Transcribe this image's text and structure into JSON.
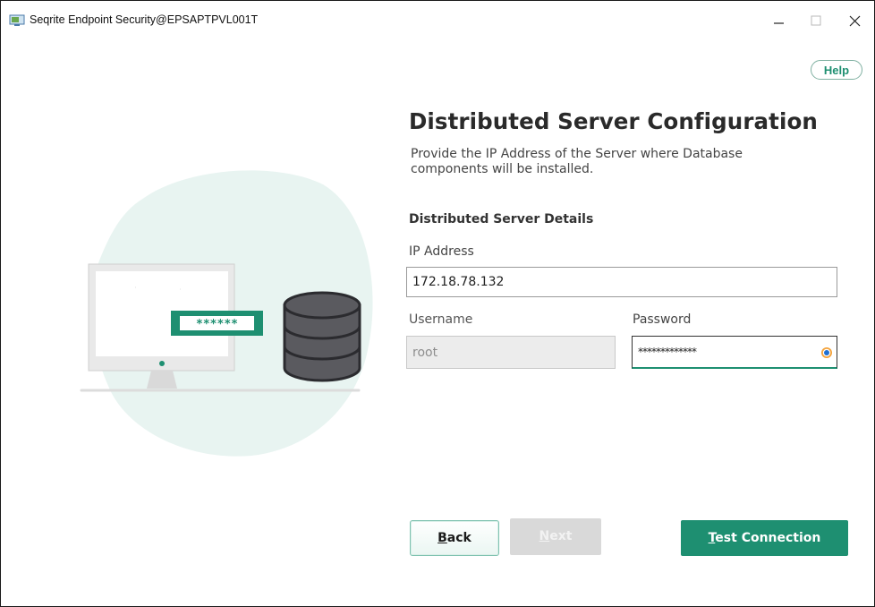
{
  "window": {
    "title": "Seqrite Endpoint Security@EPSAPTPVL001T"
  },
  "help": {
    "label": "Help"
  },
  "page": {
    "heading": "Distributed Server Configuration",
    "description": "Provide the IP Address of the Server where Database components will be installed.",
    "section_title": "Distributed Server Details"
  },
  "form": {
    "ip_label": "IP Address",
    "ip_value": "172.18.78.132",
    "username_label": "Username",
    "username_value": "root",
    "password_label": "Password",
    "password_value": "*************"
  },
  "illustration": {
    "masked_text": "******"
  },
  "buttons": {
    "back_first": "B",
    "back_rest": "ack",
    "next_first": "N",
    "next_rest": "ext",
    "test_first": "T",
    "test_rest": "est Connection"
  },
  "colors": {
    "accent": "#1e8f71",
    "blob": "#e8f4f1",
    "database": "#5a5a5f"
  }
}
